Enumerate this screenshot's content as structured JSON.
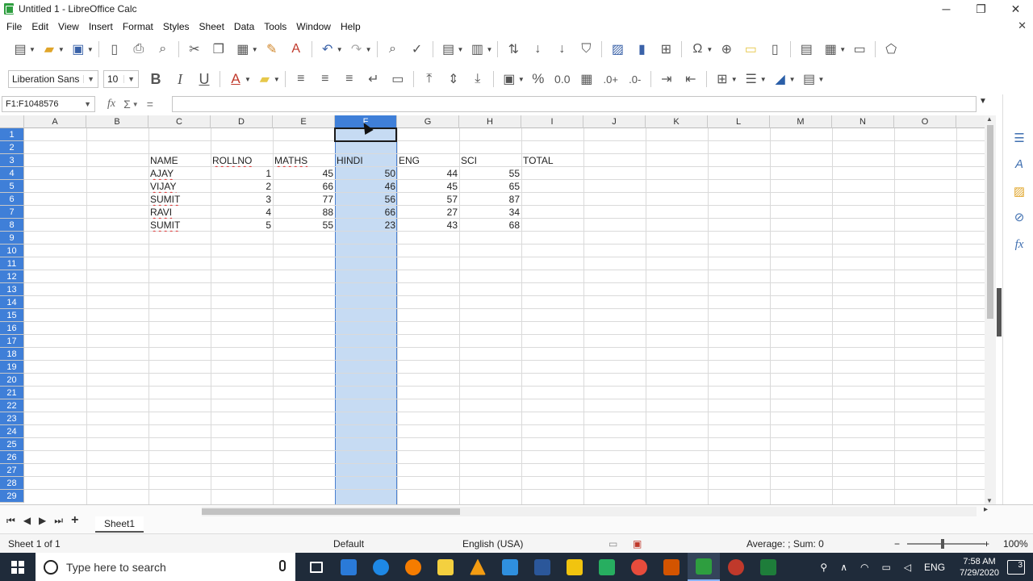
{
  "window": {
    "title": "Untitled 1 - LibreOffice Calc",
    "minimize": "─",
    "maximize": "❐",
    "close": "✕"
  },
  "menu": [
    "File",
    "Edit",
    "View",
    "Insert",
    "Format",
    "Styles",
    "Sheet",
    "Data",
    "Tools",
    "Window",
    "Help"
  ],
  "format_bar": {
    "font_name": "Liberation Sans",
    "font_size": "10",
    "bold": "B",
    "italic": "I",
    "underline": "U",
    "percent": "%",
    "decimal": "0.0",
    "add_decimal": ".0+",
    "del_decimal": ".0-"
  },
  "formula_bar": {
    "name_box": "F1:F1048576",
    "fx": "fx",
    "sum": "Σ",
    "equals": "=",
    "content": ""
  },
  "grid": {
    "columns": [
      "A",
      "B",
      "C",
      "D",
      "E",
      "F",
      "G",
      "H",
      "I",
      "J",
      "K",
      "L",
      "M",
      "N",
      "O"
    ],
    "rows": [
      "1",
      "2",
      "3",
      "4",
      "5",
      "6",
      "7",
      "8",
      "9",
      "10",
      "11",
      "12",
      "13",
      "14",
      "15",
      "16",
      "17",
      "18",
      "19",
      "20",
      "21",
      "22",
      "23",
      "24",
      "25",
      "26",
      "27",
      "28",
      "29"
    ],
    "selected_column": "F",
    "headers": {
      "C2": "NAME",
      "D2": "ROLLNO",
      "E2": "MATHS",
      "F2": "HINDI",
      "G2": "ENG",
      "H2": "SCI",
      "I2": "TOTAL"
    },
    "records": [
      {
        "name": "AJAY",
        "rollno": "1",
        "maths": "45",
        "hindi": "50",
        "eng": "44",
        "sci": "55"
      },
      {
        "name": "VIJAY",
        "rollno": "2",
        "maths": "66",
        "hindi": "46",
        "eng": "45",
        "sci": "65"
      },
      {
        "name": "SUMIT",
        "rollno": "3",
        "maths": "77",
        "hindi": "56",
        "eng": "57",
        "sci": "87"
      },
      {
        "name": "RAVI",
        "rollno": "4",
        "maths": "88",
        "hindi": "66",
        "eng": "27",
        "sci": "34"
      },
      {
        "name": "SUMIT",
        "rollno": "5",
        "maths": "55",
        "hindi": "23",
        "eng": "43",
        "sci": "68"
      }
    ]
  },
  "tabs": {
    "sheet": "Sheet1",
    "add": "+"
  },
  "status": {
    "sheet_info": "Sheet 1 of 1",
    "page_style": "Default",
    "language": "English (USA)",
    "summary": "Average: ; Sum: 0",
    "zoom": "100%",
    "zoom_minus": "−",
    "zoom_plus": "+"
  },
  "taskbar": {
    "search_placeholder": "Type here to search",
    "lang": "ENG",
    "time": "7:58 AM",
    "date": "7/29/2020",
    "notifications": "3"
  }
}
